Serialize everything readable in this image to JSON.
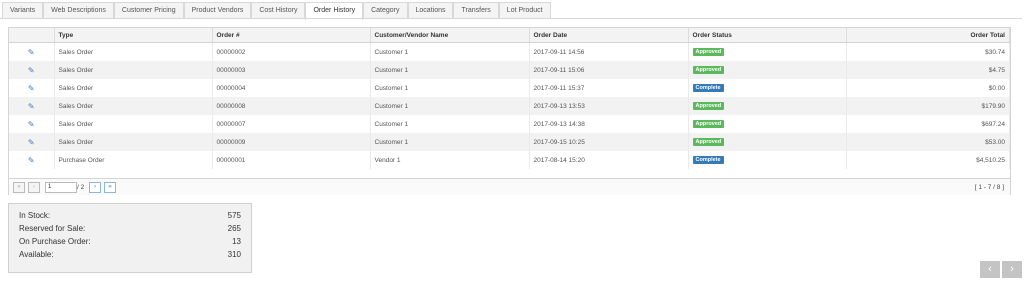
{
  "tabs": [
    "Variants",
    "Web Descriptions",
    "Customer Pricing",
    "Product Vendors",
    "Cost History",
    "Order History",
    "Category",
    "Locations",
    "Transfers",
    "Lot Product"
  ],
  "active_tab": "Order History",
  "table": {
    "columns": {
      "type": "Type",
      "order_no": "Order #",
      "name": "Customer/Vendor Name",
      "date": "Order Date",
      "status": "Order Status",
      "total": "Order Total"
    },
    "rows": [
      {
        "type": "Sales Order",
        "order_no": "00000002",
        "name": "Customer 1",
        "date": "2017-09-11 14:56",
        "status": "Approved",
        "total": "$30.74"
      },
      {
        "type": "Sales Order",
        "order_no": "00000003",
        "name": "Customer 1",
        "date": "2017-09-11 15:06",
        "status": "Approved",
        "total": "$4.75"
      },
      {
        "type": "Sales Order",
        "order_no": "00000004",
        "name": "Customer 1",
        "date": "2017-09-11 15:37",
        "status": "Complete",
        "total": "$0.00"
      },
      {
        "type": "Sales Order",
        "order_no": "00000008",
        "name": "Customer 1",
        "date": "2017-09-13 13:53",
        "status": "Approved",
        "total": "$179.90"
      },
      {
        "type": "Sales Order",
        "order_no": "00000007",
        "name": "Customer 1",
        "date": "2017-09-13 14:38",
        "status": "Approved",
        "total": "$697.24"
      },
      {
        "type": "Sales Order",
        "order_no": "00000009",
        "name": "Customer 1",
        "date": "2017-09-15 10:25",
        "status": "Approved",
        "total": "$53.00"
      },
      {
        "type": "Purchase Order",
        "order_no": "00000001",
        "name": "Vendor 1",
        "date": "2017-08-14 15:20",
        "status": "Complete",
        "total": "$4,510.25"
      }
    ]
  },
  "pager": {
    "first": "«",
    "prev": "‹",
    "page": "1",
    "total_pages": "/ 2",
    "next": "›",
    "last": "»",
    "range": "[ 1 - 7 / 8 ]"
  },
  "inventory": {
    "in_stock_label": "In Stock:",
    "in_stock": "575",
    "reserved_label": "Reserved for Sale:",
    "reserved": "265",
    "on_po_label": "On Purchase Order:",
    "on_po": "13",
    "available_label": "Available:",
    "available": "310"
  },
  "nav": {
    "prev": "‹",
    "next": "›"
  },
  "colors": {
    "approved": "#5cb85c",
    "complete": "#337ab7",
    "edit_icon": "#3a7bbf"
  },
  "icons": {
    "row_action": "pencil-icon"
  }
}
